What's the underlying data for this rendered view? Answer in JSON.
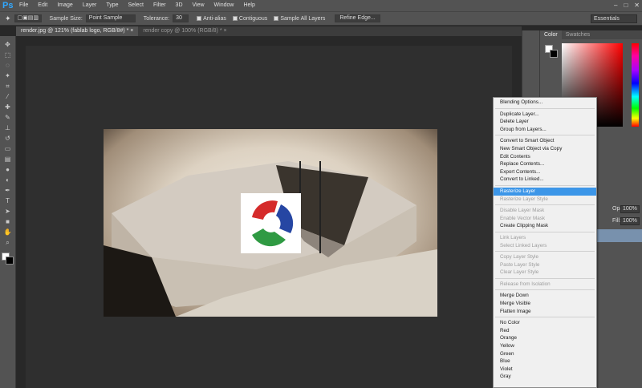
{
  "menubar": {
    "logo": "Ps",
    "items": [
      "File",
      "Edit",
      "Image",
      "Layer",
      "Type",
      "Select",
      "Filter",
      "3D",
      "View",
      "Window",
      "Help"
    ]
  },
  "options": {
    "sample_size_label": "Sample Size:",
    "sample_size_value": "Point Sample",
    "tolerance_label": "Tolerance:",
    "tolerance_value": "30",
    "anti_alias": "Anti-alias",
    "contiguous": "Contiguous",
    "sample_all": "Sample All Layers",
    "refine": "Refine Edge...",
    "workspace": "Essentials"
  },
  "tabs": [
    "render.jpg @ 121% (fablab logo, RGB/8#) * ×",
    "render copy @ 100% (RGB/8) * ×"
  ],
  "panel": {
    "color_tab": "Color",
    "swatches_tab": "Swatches",
    "opacity_label": "Opacity:",
    "opacity_value": "100%",
    "fill_label": "Fill:",
    "fill_value": "100%"
  },
  "context_menu": {
    "groups": [
      [
        {
          "label": "Blending Options...",
          "state": "enabled"
        }
      ],
      [
        {
          "label": "Duplicate Layer...",
          "state": "enabled"
        },
        {
          "label": "Delete Layer",
          "state": "enabled"
        },
        {
          "label": "Group from Layers...",
          "state": "enabled"
        }
      ],
      [
        {
          "label": "Convert to Smart Object",
          "state": "enabled"
        },
        {
          "label": "New Smart Object via Copy",
          "state": "enabled"
        },
        {
          "label": "Edit Contents",
          "state": "enabled"
        },
        {
          "label": "Replace Contents...",
          "state": "enabled"
        },
        {
          "label": "Export Contents...",
          "state": "enabled"
        },
        {
          "label": "Convert to Linked...",
          "state": "enabled"
        }
      ],
      [
        {
          "label": "Rasterize Layer",
          "state": "highlighted"
        },
        {
          "label": "Rasterize Layer Style",
          "state": "disabled"
        }
      ],
      [
        {
          "label": "Disable Layer Mask",
          "state": "disabled"
        },
        {
          "label": "Enable Vector Mask",
          "state": "disabled"
        },
        {
          "label": "Create Clipping Mask",
          "state": "enabled"
        }
      ],
      [
        {
          "label": "Link Layers",
          "state": "disabled"
        },
        {
          "label": "Select Linked Layers",
          "state": "disabled"
        }
      ],
      [
        {
          "label": "Copy Layer Style",
          "state": "disabled"
        },
        {
          "label": "Paste Layer Style",
          "state": "disabled"
        },
        {
          "label": "Clear Layer Style",
          "state": "disabled"
        }
      ],
      [
        {
          "label": "Release from Isolation",
          "state": "disabled"
        }
      ],
      [
        {
          "label": "Merge Down",
          "state": "enabled"
        },
        {
          "label": "Merge Visible",
          "state": "enabled"
        },
        {
          "label": "Flatten Image",
          "state": "enabled"
        }
      ],
      [
        {
          "label": "No Color",
          "state": "enabled"
        },
        {
          "label": "Red",
          "state": "enabled"
        },
        {
          "label": "Orange",
          "state": "enabled"
        },
        {
          "label": "Yellow",
          "state": "enabled"
        },
        {
          "label": "Green",
          "state": "enabled"
        },
        {
          "label": "Blue",
          "state": "enabled"
        },
        {
          "label": "Violet",
          "state": "enabled"
        },
        {
          "label": "Gray",
          "state": "enabled"
        }
      ]
    ]
  },
  "colors": {
    "highlight": "#3c96e8",
    "ui_bg": "#535353",
    "canvas_bg": "#282828"
  }
}
